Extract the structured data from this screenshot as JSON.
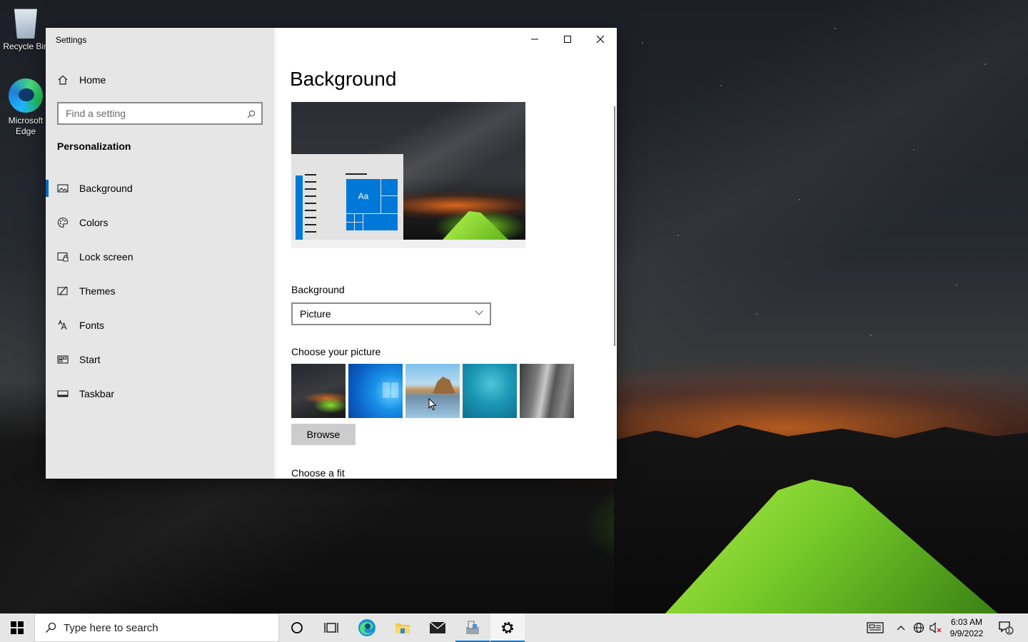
{
  "desktop": {
    "icons": [
      {
        "label": "Recycle Bin",
        "icon": "recycle-bin-icon"
      },
      {
        "label": "Microsoft Edge",
        "icon": "edge-icon"
      }
    ]
  },
  "window": {
    "title": "Settings",
    "controls": [
      "minimize-icon",
      "maximize-icon",
      "close-icon"
    ]
  },
  "sidebar": {
    "home_label": "Home",
    "search_placeholder": "Find a setting",
    "section_title": "Personalization",
    "items": [
      {
        "label": "Background",
        "icon": "picture-icon",
        "active": true
      },
      {
        "label": "Colors",
        "icon": "palette-icon",
        "active": false
      },
      {
        "label": "Lock screen",
        "icon": "lock-screen-icon",
        "active": false
      },
      {
        "label": "Themes",
        "icon": "themes-icon",
        "active": false
      },
      {
        "label": "Fonts",
        "icon": "fonts-icon",
        "active": false
      },
      {
        "label": "Start",
        "icon": "start-icon",
        "active": false
      },
      {
        "label": "Taskbar",
        "icon": "taskbar-icon",
        "active": false
      }
    ]
  },
  "content": {
    "page_title": "Background",
    "preview_tile_text": "Aa",
    "background_label": "Background",
    "background_value": "Picture",
    "choose_picture_label": "Choose your picture",
    "browse_label": "Browse",
    "choose_fit_label": "Choose a fit"
  },
  "taskbar": {
    "search_placeholder": "Type here to search",
    "apps": [
      "cortana-icon",
      "task-view-icon",
      "edge-icon",
      "file-explorer-icon",
      "mail-icon",
      "app-icon",
      "settings-icon"
    ],
    "time": "6:03 AM",
    "date": "9/9/2022",
    "notification_count": "1"
  },
  "colors": {
    "accent": "#0078d7",
    "sidebar_bg": "#e6e6e6",
    "taskbar_bg": "#e6e6e6"
  }
}
